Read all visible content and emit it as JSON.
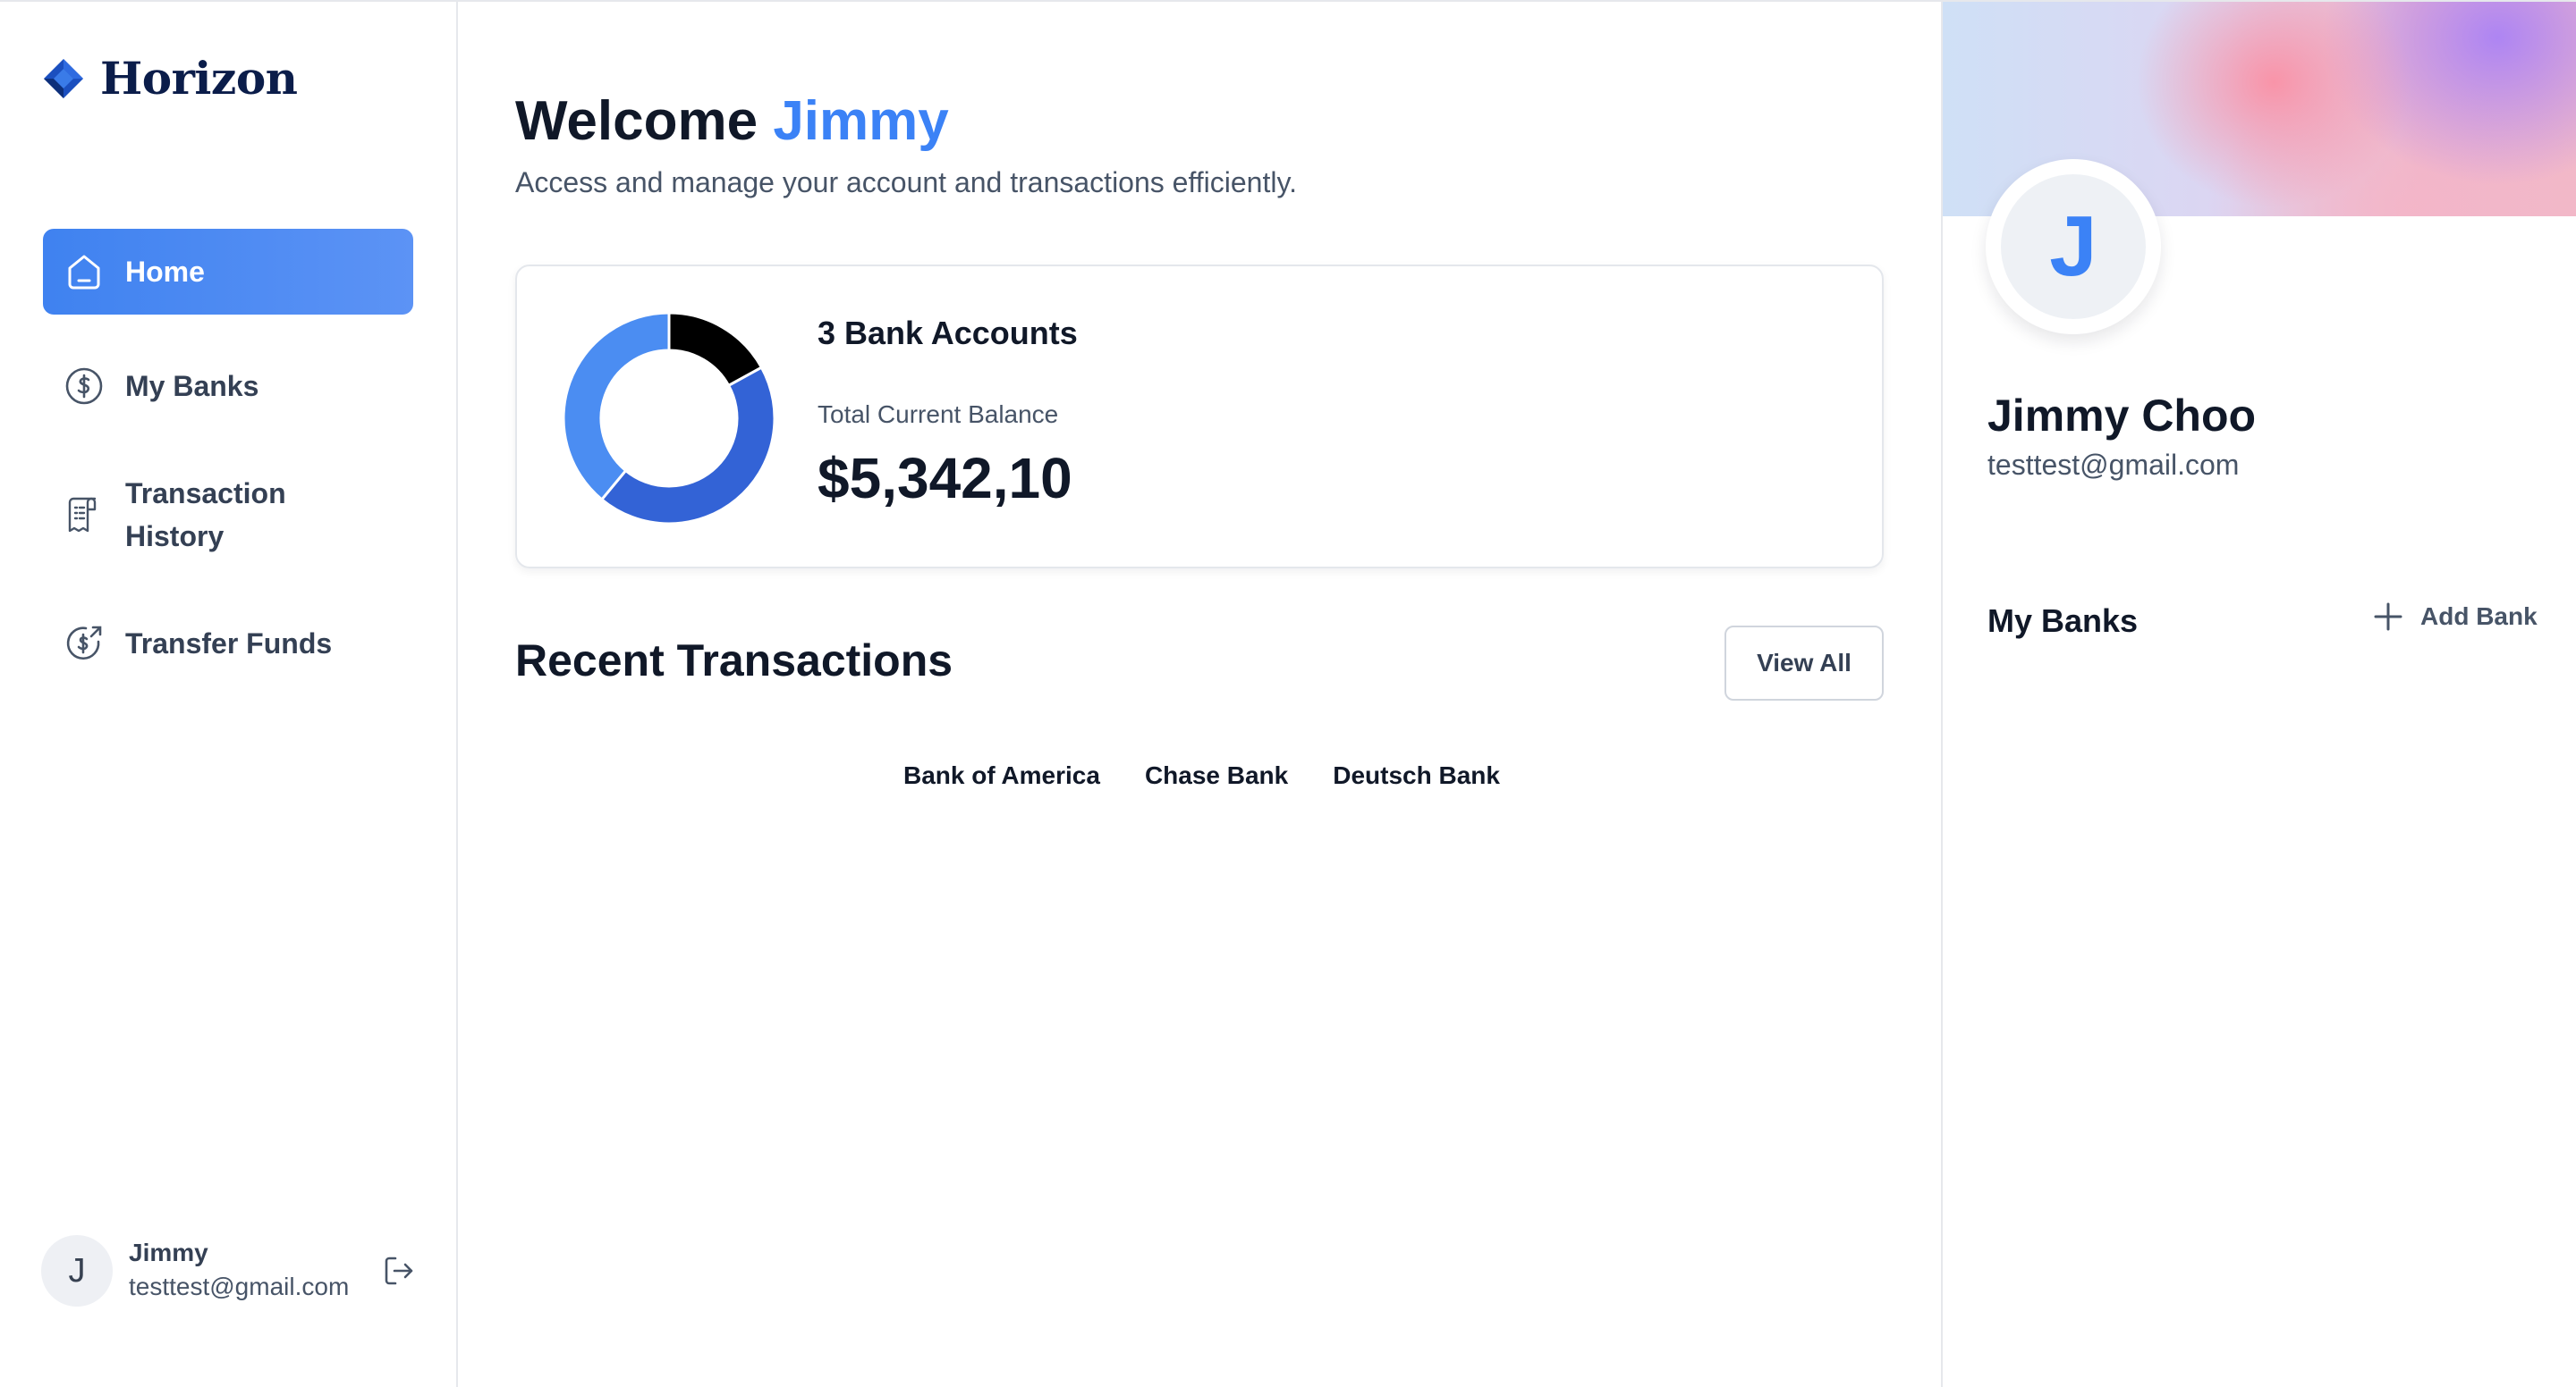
{
  "brand": {
    "name": "Horizon"
  },
  "sidebar": {
    "items": [
      {
        "label": "Home",
        "icon": "home-icon",
        "active": true
      },
      {
        "label": "My Banks",
        "icon": "dollar-circle-icon",
        "active": false
      },
      {
        "label": "Transaction History",
        "line1": "Transaction",
        "line2": "History",
        "icon": "receipt-icon",
        "active": false
      },
      {
        "label": "Transfer Funds",
        "icon": "money-send-icon",
        "active": false
      }
    ],
    "footer": {
      "avatar_initial": "J",
      "name": "Jimmy",
      "email": "testtest@gmail.com",
      "logout_icon": "logout-icon"
    }
  },
  "header": {
    "greeting": "Welcome",
    "user_first_name": "Jimmy",
    "subtitle": "Access and manage your account and transactions efficiently."
  },
  "balance": {
    "accounts_label": "3 Bank Accounts",
    "total_label": "Total Current Balance",
    "total_amount": "$5,342,10"
  },
  "chart_data": {
    "type": "pie",
    "donut": true,
    "series": [
      {
        "value": 17,
        "color": "#000000"
      },
      {
        "value": 44,
        "color": "#3363d6"
      },
      {
        "value": 39,
        "color": "#4b8df2"
      }
    ]
  },
  "recent": {
    "title": "Recent Transactions",
    "view_all_label": "View All",
    "bank_tabs": [
      "Bank of America",
      "Chase Bank",
      "Deutsch Bank"
    ]
  },
  "profile": {
    "avatar_initial": "J",
    "name": "Jimmy Choo",
    "email": "testtest@gmail.com"
  },
  "my_banks": {
    "title": "My Banks",
    "add_label": "Add Bank"
  },
  "colors": {
    "accent": "#3b82f6",
    "text_primary": "#101828",
    "text_secondary": "#475467"
  }
}
